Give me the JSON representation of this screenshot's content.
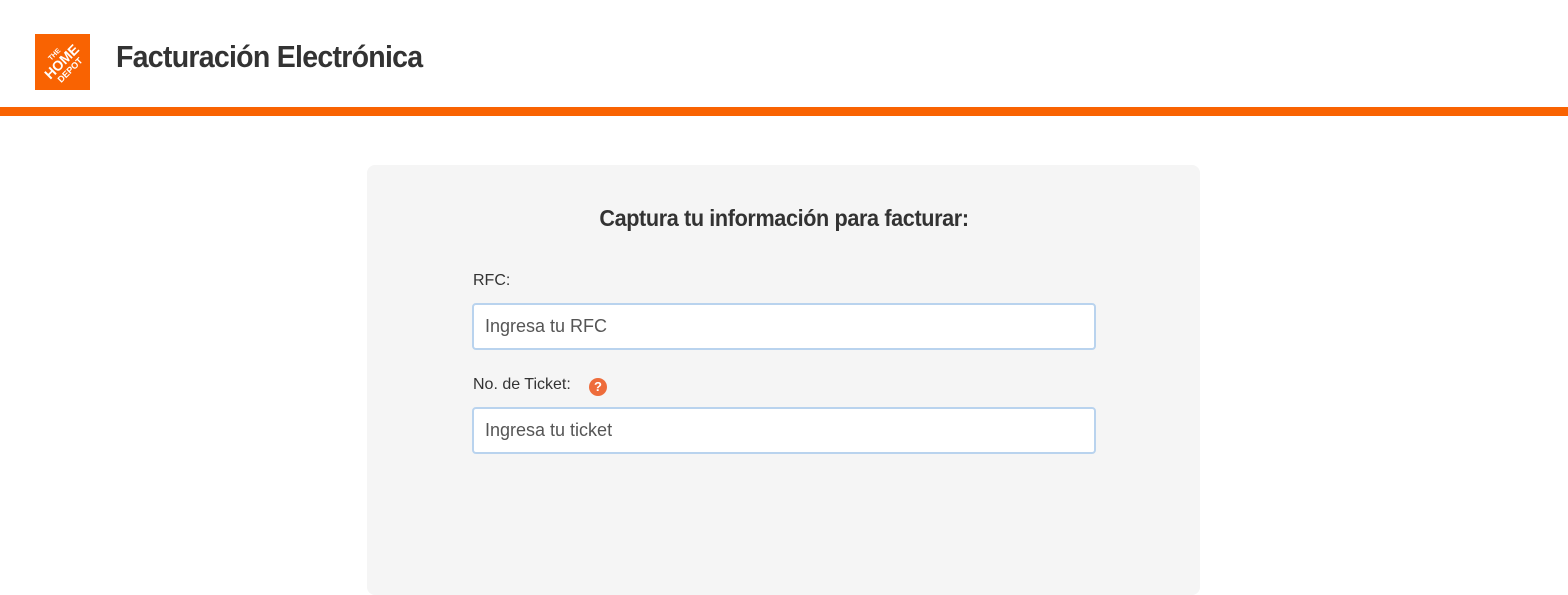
{
  "header": {
    "logo_alt": "THE HOME DEPOT",
    "logo_lines": [
      "THE",
      "HOME",
      "DEPOT"
    ],
    "title": "Facturación Electrónica",
    "brand_color": "#f96302"
  },
  "form": {
    "heading": "Captura tu información para facturar:",
    "rfc": {
      "label": "RFC:",
      "value": "",
      "placeholder": "Ingresa tu RFC"
    },
    "ticket": {
      "label": "No. de Ticket:",
      "help_icon": "?",
      "value": "",
      "placeholder": "Ingresa tu ticket"
    }
  }
}
